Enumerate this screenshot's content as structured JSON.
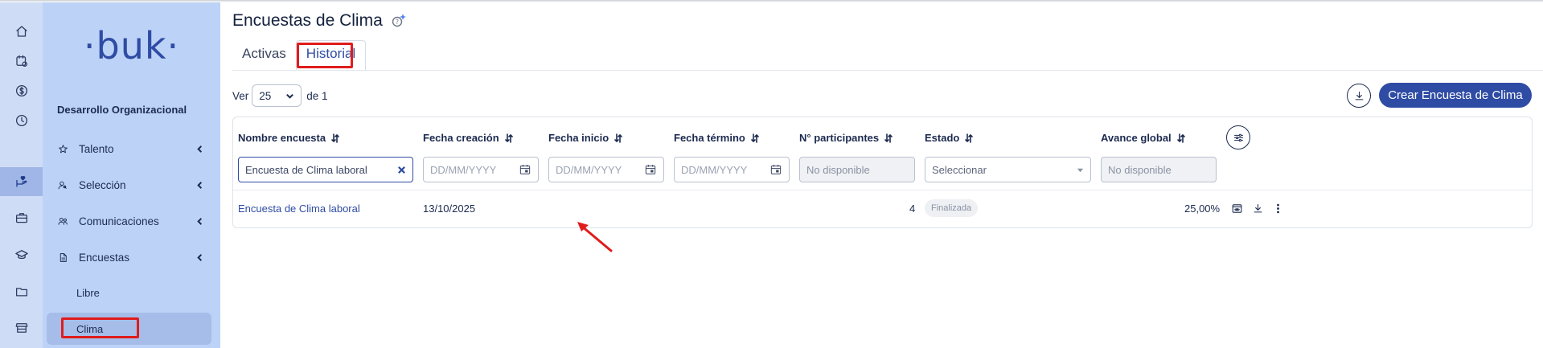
{
  "app": {
    "logo_text": "·buk·",
    "brand_color": "#2f4ca4",
    "annotation_color": "#e01c1c"
  },
  "rail": {
    "icons": [
      {
        "name": "home-icon"
      },
      {
        "name": "calendar-clock-icon"
      },
      {
        "name": "dollar-icon"
      },
      {
        "name": "clock-icon"
      },
      {
        "name": "hand-heart-icon",
        "active": true
      },
      {
        "name": "briefcase-icon"
      },
      {
        "name": "graduation-cap-icon"
      },
      {
        "name": "folder-icon"
      },
      {
        "name": "store-icon"
      }
    ]
  },
  "sidebar": {
    "section_title": "Desarrollo Organizacional",
    "items": [
      {
        "label": "Talento",
        "icon": "star-icon"
      },
      {
        "label": "Selección",
        "icon": "user-search-icon"
      },
      {
        "label": "Comunicaciones",
        "icon": "users-icon"
      },
      {
        "label": "Encuestas",
        "icon": "document-icon"
      }
    ],
    "subitems": [
      {
        "label": "Libre"
      },
      {
        "label": "Clima",
        "active": true
      }
    ]
  },
  "main": {
    "title": "Encuestas de Clima",
    "tabs": [
      {
        "label": "Activas"
      },
      {
        "label": "Historial",
        "active": true
      }
    ],
    "pager": {
      "prefix": "Ver",
      "value": "25",
      "suffix": "de 1"
    },
    "create_button": "Crear Encuesta de Clima",
    "table": {
      "columns": [
        "Nombre encuesta",
        "Fecha creación",
        "Fecha inicio",
        "Fecha término",
        "N° participantes",
        "Estado",
        "Avance global"
      ],
      "filters": {
        "name_value": "Encuesta de Clima laboral",
        "date_placeholder": "DD/MM/YYYY",
        "disabled_placeholder": "No disponible",
        "state_placeholder": "Seleccionar"
      },
      "rows": [
        {
          "name": "Encuesta de Clima laboral",
          "created": "13/10/2025",
          "participants": "4",
          "status": "Finalizada",
          "progress": "25,00%"
        }
      ]
    }
  }
}
